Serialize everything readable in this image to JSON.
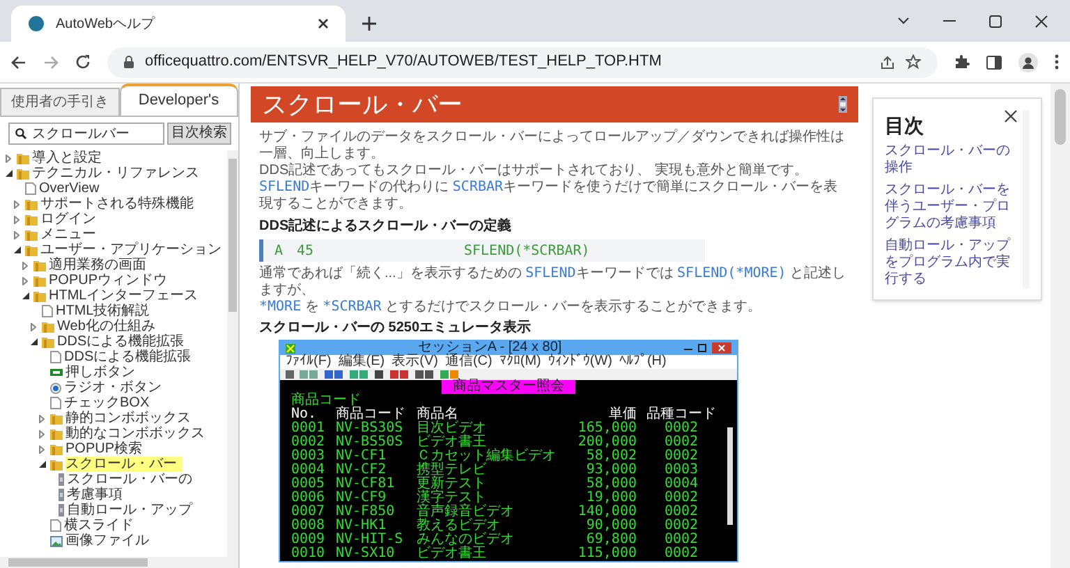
{
  "browser": {
    "tab_title": "AutoWebヘルプ",
    "url": "officequattro.com/ENTSVR_HELP_V70/AUTOWEB/TEST_HELP_TOP.HTM"
  },
  "sidebar": {
    "tabs": [
      {
        "label": "使用者の手引き",
        "selected": false
      },
      {
        "label": "Developer's",
        "selected": true
      }
    ],
    "search": {
      "value": "スクロールバー",
      "button": "目次検索"
    },
    "tree": [
      {
        "label": "導入と設定",
        "kind": "folder",
        "expanded": false,
        "selected": false
      },
      {
        "label": "テクニカル・リファレンス",
        "kind": "folder",
        "expanded": true,
        "selected": false,
        "children": [
          {
            "label": "OverView",
            "kind": "page",
            "selected": false
          },
          {
            "label": "サポートされる特殊機能",
            "kind": "folder",
            "expanded": false,
            "selected": false
          },
          {
            "label": "ログイン",
            "kind": "folder",
            "expanded": false,
            "selected": false
          },
          {
            "label": "メニュー",
            "kind": "folder",
            "expanded": false,
            "selected": false
          },
          {
            "label": "ユーザー・アプリケーション",
            "kind": "folder",
            "expanded": true,
            "selected": false,
            "children": [
              {
                "label": "適用業務の画面",
                "kind": "folder",
                "expanded": false,
                "selected": false
              },
              {
                "label": "POPUPウィンドウ",
                "kind": "folder",
                "expanded": false,
                "selected": false
              },
              {
                "label": "HTMLインターフェース",
                "kind": "folder",
                "expanded": true,
                "selected": false,
                "children": [
                  {
                    "label": "HTML技術解説",
                    "kind": "page",
                    "selected": false
                  },
                  {
                    "label": "Web化の仕組み",
                    "kind": "folder",
                    "expanded": false,
                    "selected": false
                  },
                  {
                    "label": "DDSによる機能拡張",
                    "kind": "folder",
                    "expanded": true,
                    "selected": false,
                    "children": [
                      {
                        "label": "DDSによる機能拡張",
                        "kind": "page",
                        "selected": false
                      },
                      {
                        "label": "押しボタン",
                        "kind": "button",
                        "selected": false
                      },
                      {
                        "label": "ラジオ・ボタン",
                        "kind": "radio",
                        "selected": false
                      },
                      {
                        "label": "チェックBOX",
                        "kind": "page",
                        "selected": false
                      },
                      {
                        "label": "静的コンボボックス",
                        "kind": "folder",
                        "expanded": false,
                        "selected": false
                      },
                      {
                        "label": "動的なコンボボックス",
                        "kind": "folder",
                        "expanded": false,
                        "selected": false
                      },
                      {
                        "label": "POPUP検索",
                        "kind": "folder",
                        "expanded": false,
                        "selected": false
                      },
                      {
                        "label": "スクロール・バー",
                        "kind": "folder",
                        "expanded": true,
                        "selected": true,
                        "children": [
                          {
                            "label": "スクロール・バーの",
                            "kind": "scroll",
                            "selected": false
                          },
                          {
                            "label": "考慮事項",
                            "kind": "scroll",
                            "selected": false
                          },
                          {
                            "label": "自動ロール・アップ",
                            "kind": "scroll",
                            "selected": false
                          }
                        ]
                      },
                      {
                        "label": "横スライド",
                        "kind": "page",
                        "selected": false
                      },
                      {
                        "label": "画像ファイル",
                        "kind": "image",
                        "selected": false
                      }
                    ]
                  }
                ]
              }
            ]
          }
        ]
      }
    ]
  },
  "article": {
    "title": "スクロール・バー",
    "intro": [
      [
        {
          "kind": "text",
          "text": "サブ・ファイルのデータをスクロール・バーによってロールアップ／ダウンできれば操作性は一層、向上します。"
        }
      ],
      [
        {
          "kind": "text",
          "text": "DDS記述であってもスクロール・バーはサポートされており、 実現も意外と簡単です。"
        }
      ],
      [
        {
          "kind": "code",
          "text": "SFLEND"
        },
        {
          "kind": "text",
          "text": "キーワードの代わりに "
        },
        {
          "kind": "code",
          "text": "SCRBAR"
        },
        {
          "kind": "text",
          "text": "キーワードを使うだけで簡単にスクロール・バーを表現することができます。"
        }
      ]
    ],
    "heading_1": "DDS記述によるスクロール・バーの定義",
    "code_line": [
      "A",
      "45",
      "SFLEND(*SCRBAR)"
    ],
    "body": [
      [
        {
          "kind": "text",
          "text": "通常であれば「続く...」を表示するための "
        },
        {
          "kind": "code",
          "text": "SFLEND"
        },
        {
          "kind": "text",
          "text": "キーワードでは "
        },
        {
          "kind": "code",
          "text": "SFLEND(*MORE)"
        },
        {
          "kind": "text",
          "text": " と記述しますが、"
        }
      ],
      [
        {
          "kind": "code",
          "text": "*MORE"
        },
        {
          "kind": "text",
          "text": " を "
        },
        {
          "kind": "code",
          "text": "*SCRBAR"
        },
        {
          "kind": "text",
          "text": " とするだけでスクロール・バーを表示することができます。"
        }
      ]
    ],
    "heading_2": "スクロール・バーの 5250エミュレータ表示",
    "emulator": {
      "title": "セッションA - [24 x 80]",
      "menu": [
        "ﾌｧｲﾙ(F)",
        "編集(E)",
        "表示(V)",
        "通信(C)",
        "ﾏｸﾛ(M)",
        "ｳｨﾝﾄﾞｳ(W)",
        "ﾍﾙﾌﾟ(H)"
      ],
      "screen_title": "商品マスター照会",
      "field_label": "商品コード",
      "columns": [
        "No.",
        "商品コード",
        "商品名",
        "単価",
        "品種コード"
      ],
      "rows": [
        [
          "0001",
          "NV-BS30S",
          "目次ビデオ",
          "165,000",
          "0002"
        ],
        [
          "0002",
          "NV-BS50S",
          "ビデオ書王",
          "200,000",
          "0002"
        ],
        [
          "0003",
          "NV-CF1",
          "Ｃカセット編集ビデオ",
          "58,002",
          "0002"
        ],
        [
          "0004",
          "NV-CF2",
          "携型テレビ",
          "93,000",
          "0003"
        ],
        [
          "0005",
          "NV-CF81",
          "更新テスト",
          "58,000",
          "0004"
        ],
        [
          "0006",
          "NV-CF9",
          "漢字テスト",
          "19,000",
          "0002"
        ],
        [
          "0007",
          "NV-F850",
          "音声録音ビデオ",
          "140,000",
          "0002"
        ],
        [
          "0008",
          "NV-HK1",
          "教えるビデオ",
          "90,000",
          "0002"
        ],
        [
          "0009",
          "NV-HIT-S",
          "みんなのビデオ",
          "69,800",
          "0002"
        ],
        [
          "0010",
          "NV-SX10",
          "ビデオ書王",
          "115,000",
          "0002"
        ]
      ]
    }
  },
  "toc": {
    "title": "目次",
    "links": [
      "スクロール・バーの操作",
      "スクロール・バーを伴うユーザー・プログラムの考慮事項",
      "自動ロール・アップをプログラム内で実行する"
    ]
  }
}
